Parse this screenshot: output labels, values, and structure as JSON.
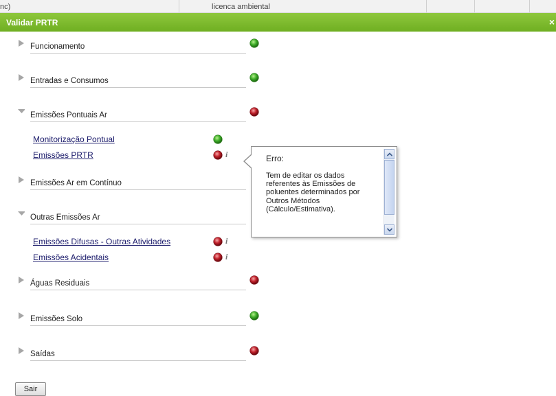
{
  "background": {
    "col1_text": "nc)",
    "col2_text": "licenca ambiental"
  },
  "dialog": {
    "title": "Validar PRTR",
    "close_label": "×"
  },
  "colors": {
    "green_status": "#3fae2a",
    "red_status": "#c0202a",
    "titlebar": "#7dbb2e",
    "link": "#1b1b6b"
  },
  "sections": [
    {
      "label": "Funcionamento",
      "status": "green",
      "expanded": false
    },
    {
      "label": "Entradas e Consumos",
      "status": "green",
      "expanded": false
    },
    {
      "label": "Emissões Pontuais Ar",
      "status": "red",
      "expanded": true,
      "items": [
        {
          "label": "Monitorização Pontual",
          "status": "green",
          "info": false
        },
        {
          "label": "Emissões PRTR",
          "status": "red",
          "info": true
        }
      ]
    },
    {
      "label": "Emissões Ar em Contínuo",
      "status": "",
      "expanded": false
    },
    {
      "label": "Outras Emissões Ar",
      "status": "",
      "expanded": true,
      "items": [
        {
          "label": "Emissões Difusas - Outras Atividades",
          "status": "red",
          "info": true
        },
        {
          "label": "Emissões Acidentais",
          "status": "red",
          "info": true
        }
      ]
    },
    {
      "label": "Águas Residuais",
      "status": "red",
      "expanded": false
    },
    {
      "label": "Emissões Solo",
      "status": "green",
      "expanded": false
    },
    {
      "label": "Saídas",
      "status": "red",
      "expanded": false
    }
  ],
  "info_icon": "i",
  "tooltip": {
    "title": "Erro:",
    "body": "Tem de editar os dados referentes às Emissões de poluentes determinados por Outros Métodos (Cálculo/Estimativa)."
  },
  "footer": {
    "exit_label": "Sair"
  }
}
